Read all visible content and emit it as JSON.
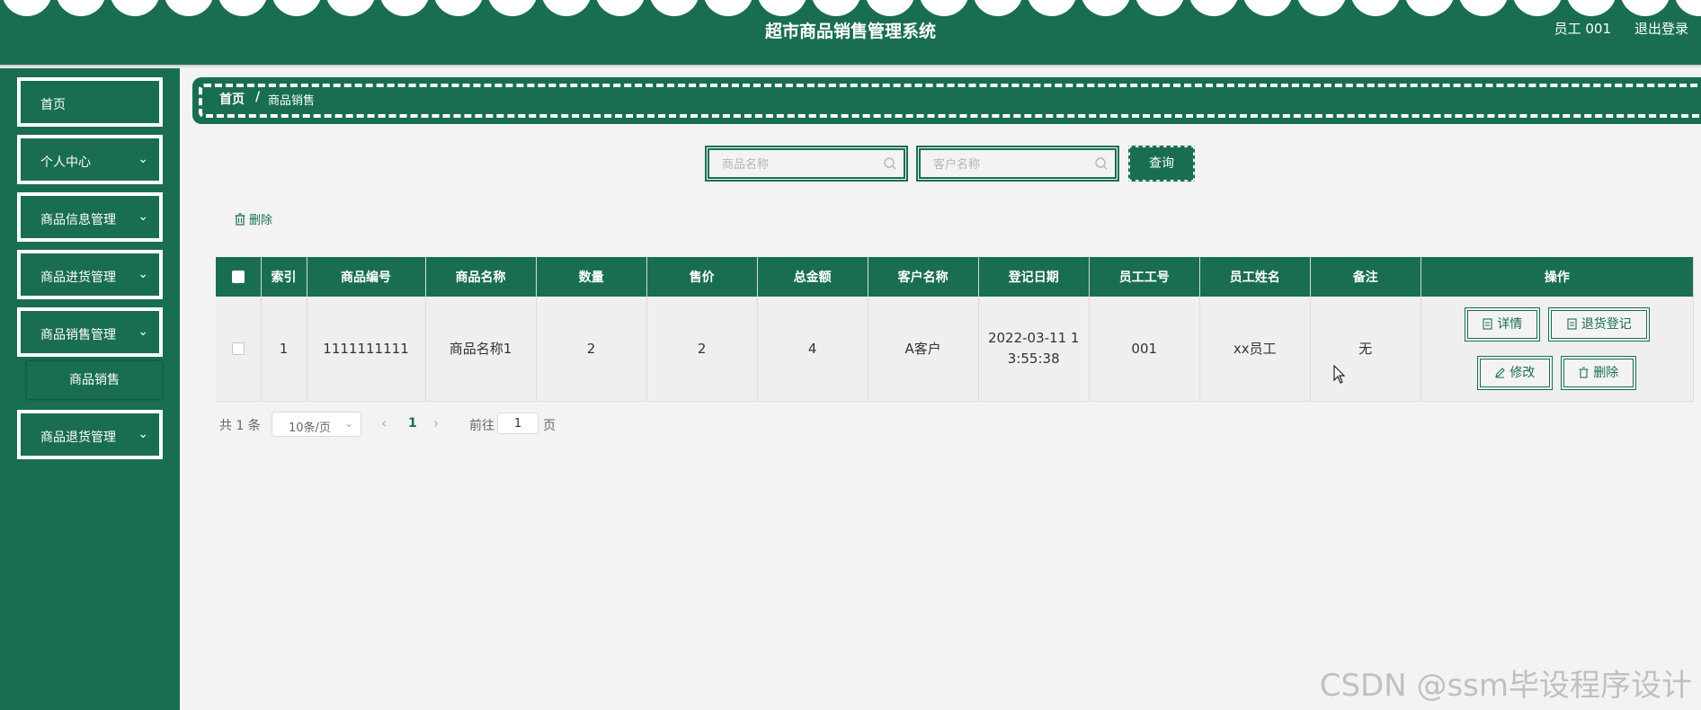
{
  "header": {
    "title": "超市商品销售管理系统",
    "user": "员工 001",
    "logout": "退出登录"
  },
  "sidebar": {
    "items": [
      {
        "label": "首页"
      },
      {
        "label": "个人中心"
      },
      {
        "label": "商品信息管理"
      },
      {
        "label": "商品进货管理"
      },
      {
        "label": "商品销售管理"
      },
      {
        "label": "商品退货管理"
      }
    ],
    "active_sub": "商品销售"
  },
  "breadcrumb": {
    "home": "首页",
    "separator": "/",
    "current": "商品销售"
  },
  "search": {
    "product_placeholder": "商品名称",
    "customer_placeholder": "客户名称",
    "query_label": "查询"
  },
  "toolbar": {
    "delete_label": "删除"
  },
  "table": {
    "columns": [
      "索引",
      "商品编号",
      "商品名称",
      "数量",
      "售价",
      "总金额",
      "客户名称",
      "登记日期",
      "员工工号",
      "员工姓名",
      "备注",
      "操作"
    ],
    "rows": [
      {
        "index": "1",
        "code": "1111111111",
        "name": "商品名称1",
        "quantity": "2",
        "price": "2",
        "total": "4",
        "customer": "A客户",
        "date": "2022-03-11 13:55:38",
        "emp_no": "001",
        "emp_name": "xx员工",
        "remark": "无",
        "actions": {
          "detail": "详情",
          "return": "退货登记",
          "edit": "修改",
          "delete": "删除"
        }
      }
    ]
  },
  "pagination": {
    "total": "共 1 条",
    "page_size": "10条/页",
    "current_page": "1",
    "goto_label": "前往",
    "goto_value": "1",
    "goto_suffix": "页"
  },
  "watermark": "CSDN @ssm毕设程序设计",
  "colors": {
    "primary": "#196e4f",
    "background": "#f3f3f3"
  }
}
